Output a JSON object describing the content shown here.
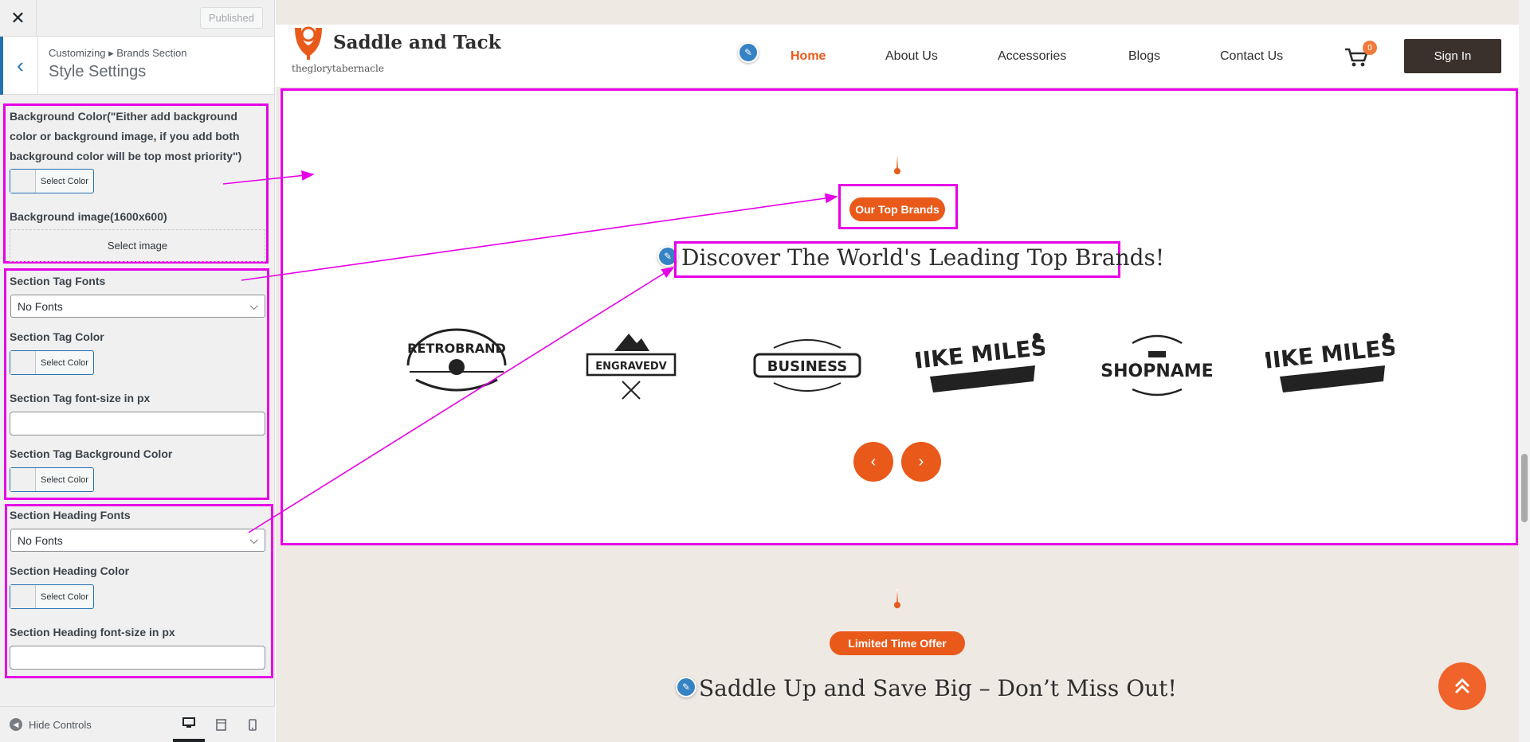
{
  "sidebar": {
    "close_icon": "close-icon",
    "published_label": "Published",
    "breadcrumb": "Customizing ▸ Brands Section",
    "title": "Style Settings",
    "bg_color_label": "Background Color(\"Either add background color or background image, if you add both background color will be top most priority\")",
    "select_color": "Select Color",
    "bg_image_label": "Background image(1600x600)",
    "select_image": "Select image",
    "tag_fonts_label": "Section Tag Fonts",
    "tag_fonts_value": "No Fonts",
    "tag_color_label": "Section Tag Color",
    "tag_fontsize_label": "Section Tag font-size in px",
    "tag_bg_label": "Section Tag Background Color",
    "heading_fonts_label": "Section Heading Fonts",
    "heading_fonts_value": "No Fonts",
    "heading_color_label": "Section Heading Color",
    "heading_fontsize_label": "Section Heading font-size in px",
    "hide_controls": "Hide Controls"
  },
  "site": {
    "brand_name": "Saddle and Tack",
    "brand_tagline": "theglorytabernacle",
    "nav": [
      "Home",
      "About Us",
      "Accessories",
      "Blogs",
      "Contact Us"
    ],
    "cart_count": "0",
    "signin": "Sign In"
  },
  "brands": {
    "tag": "Our Top Brands",
    "heading": "Discover The World's Leading Top Brands!",
    "logos": [
      "RETROBRAND",
      "ENGRAVEDV",
      "BUSINESS",
      "MIKE MILES",
      "SHOPNAME",
      "MIKE MILES"
    ]
  },
  "offer": {
    "tag": "Limited Time Offer",
    "heading": "Saddle Up and Save Big – Don’t Miss Out!"
  },
  "colors": {
    "accent": "#e8591a",
    "highlight": "#e600e6",
    "dark_button": "#3a302c",
    "wp_blue": "#2271b1"
  }
}
